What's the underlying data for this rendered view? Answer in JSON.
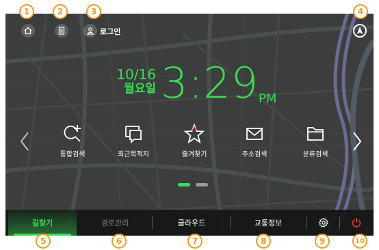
{
  "topbar": {
    "home_icon": "home-icon",
    "list_icon": "list-icon",
    "user_icon": "user-icon",
    "login_label": "로그인",
    "compass_icon": "compass-icon"
  },
  "clock": {
    "date": "10/16",
    "weekday": "월요일",
    "time": "3:29",
    "ampm": "PM"
  },
  "menu": {
    "items": [
      {
        "label": "통합검색",
        "icon": "search-plus-icon"
      },
      {
        "label": "최근목적지",
        "icon": "recent-destinations-icon"
      },
      {
        "label": "즐겨찾기",
        "icon": "star-icon"
      },
      {
        "label": "주소검색",
        "icon": "envelope-icon"
      },
      {
        "label": "분류검색",
        "icon": "folder-icon"
      }
    ]
  },
  "pager": {
    "pages": 2,
    "current": 1
  },
  "bottombar": {
    "items": [
      {
        "label": "길찾기",
        "state": "active"
      },
      {
        "label": "경로관리",
        "state": "disabled"
      },
      {
        "label": "클라우드",
        "state": "normal"
      },
      {
        "label": "교통정보",
        "state": "normal"
      }
    ],
    "settings_icon": "gear-icon",
    "power_icon": "power-icon"
  },
  "markers": [
    "1",
    "2",
    "3",
    "4",
    "5",
    "6",
    "7",
    "8",
    "9",
    "10"
  ],
  "colors": {
    "accent": "#3bdc57",
    "marker": "#f39a1f",
    "power": "#e8352b"
  }
}
